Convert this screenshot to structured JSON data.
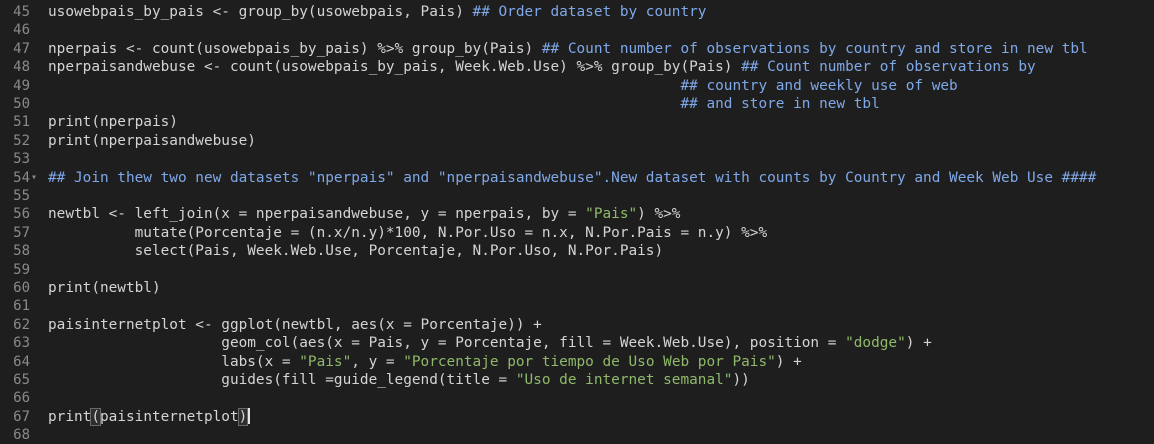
{
  "editor": {
    "lines": [
      {
        "n": "45",
        "fold": false,
        "segments": [
          {
            "t": "usowebpais_by_pais <- group_by(usowebpais, Pais) ",
            "k": "plain"
          },
          {
            "t": "## Order dataset by country",
            "k": "comment"
          }
        ]
      },
      {
        "n": "46",
        "fold": false,
        "segments": []
      },
      {
        "n": "47",
        "fold": false,
        "segments": [
          {
            "t": "nperpais <- count(usowebpais_by_pais) %>% group_by(Pais) ",
            "k": "plain"
          },
          {
            "t": "## Count number of observations by country and store in new tbl",
            "k": "comment"
          }
        ]
      },
      {
        "n": "48",
        "fold": false,
        "segments": [
          {
            "t": "nperpaisandwebuse <- count(usowebpais_by_pais, Week.Web.Use) %>% group_by(Pais) ",
            "k": "plain"
          },
          {
            "t": "## Count number of observations by",
            "k": "comment"
          }
        ]
      },
      {
        "n": "49",
        "fold": false,
        "segments": [
          {
            "t": "                                                                         ",
            "k": "plain"
          },
          {
            "t": "## country and weekly use of web",
            "k": "comment"
          }
        ]
      },
      {
        "n": "50",
        "fold": false,
        "segments": [
          {
            "t": "                                                                         ",
            "k": "plain"
          },
          {
            "t": "## and store in new tbl",
            "k": "comment"
          }
        ]
      },
      {
        "n": "51",
        "fold": false,
        "segments": [
          {
            "t": "print(nperpais)",
            "k": "plain"
          }
        ]
      },
      {
        "n": "52",
        "fold": false,
        "segments": [
          {
            "t": "print(nperpaisandwebuse)",
            "k": "plain"
          }
        ]
      },
      {
        "n": "53",
        "fold": false,
        "segments": []
      },
      {
        "n": "54",
        "fold": true,
        "segments": [
          {
            "t": "## Join thew two new datasets \"nperpais\" and \"nperpaisandwebuse\".New dataset with counts by Country and Week Web Use ####",
            "k": "comment"
          }
        ]
      },
      {
        "n": "55",
        "fold": false,
        "segments": []
      },
      {
        "n": "56",
        "fold": false,
        "segments": [
          {
            "t": "newtbl <- left_join(x = nperpaisandwebuse, y = nperpais, by = ",
            "k": "plain"
          },
          {
            "t": "\"Pais\"",
            "k": "string"
          },
          {
            "t": ") %>%",
            "k": "plain"
          }
        ]
      },
      {
        "n": "57",
        "fold": false,
        "segments": [
          {
            "t": "          mutate(Porcentaje = (n.x/n.y)*100, N.Por.Uso = n.x, N.Por.Pais = n.y) %>%",
            "k": "plain"
          }
        ]
      },
      {
        "n": "58",
        "fold": false,
        "segments": [
          {
            "t": "          select(Pais, Week.Web.Use, Porcentaje, N.Por.Uso, N.Por.Pais)",
            "k": "plain"
          }
        ]
      },
      {
        "n": "59",
        "fold": false,
        "segments": []
      },
      {
        "n": "60",
        "fold": false,
        "segments": [
          {
            "t": "print(newtbl)",
            "k": "plain"
          }
        ]
      },
      {
        "n": "61",
        "fold": false,
        "segments": []
      },
      {
        "n": "62",
        "fold": false,
        "segments": [
          {
            "t": "paisinternetplot <- ggplot(newtbl, aes(x = Porcentaje)) +",
            "k": "plain"
          }
        ]
      },
      {
        "n": "63",
        "fold": false,
        "segments": [
          {
            "t": "                    geom_col(aes(x = Pais, y = Porcentaje, fill = Week.Web.Use), position = ",
            "k": "plain"
          },
          {
            "t": "\"dodge\"",
            "k": "string"
          },
          {
            "t": ") +",
            "k": "plain"
          }
        ]
      },
      {
        "n": "64",
        "fold": false,
        "segments": [
          {
            "t": "                    labs(x = ",
            "k": "plain"
          },
          {
            "t": "\"Pais\"",
            "k": "string"
          },
          {
            "t": ", y = ",
            "k": "plain"
          },
          {
            "t": "\"Porcentaje por tiempo de Uso Web por Pais\"",
            "k": "string"
          },
          {
            "t": ") +",
            "k": "plain"
          }
        ]
      },
      {
        "n": "65",
        "fold": false,
        "segments": [
          {
            "t": "                    guides(fill =guide_legend(title = ",
            "k": "plain"
          },
          {
            "t": "\"Uso de internet semanal\"",
            "k": "string"
          },
          {
            "t": "))",
            "k": "plain"
          }
        ]
      },
      {
        "n": "66",
        "fold": false,
        "segments": []
      },
      {
        "n": "67",
        "fold": false,
        "cursor": true,
        "segments": [
          {
            "t": "print",
            "k": "plain"
          },
          {
            "t": "(",
            "k": "bracket"
          },
          {
            "t": "paisinternetplot",
            "k": "plain"
          },
          {
            "t": ")",
            "k": "bracket"
          }
        ]
      },
      {
        "n": "68",
        "fold": false,
        "segments": []
      }
    ],
    "colors": {
      "background": "#1e1e1e",
      "comment": "#7fa8e8",
      "string": "#8fb96a",
      "plain": "#d4d4d4",
      "line_number": "#8a8a8a"
    },
    "icons": {
      "fold": "fold-arrow-icon"
    }
  }
}
